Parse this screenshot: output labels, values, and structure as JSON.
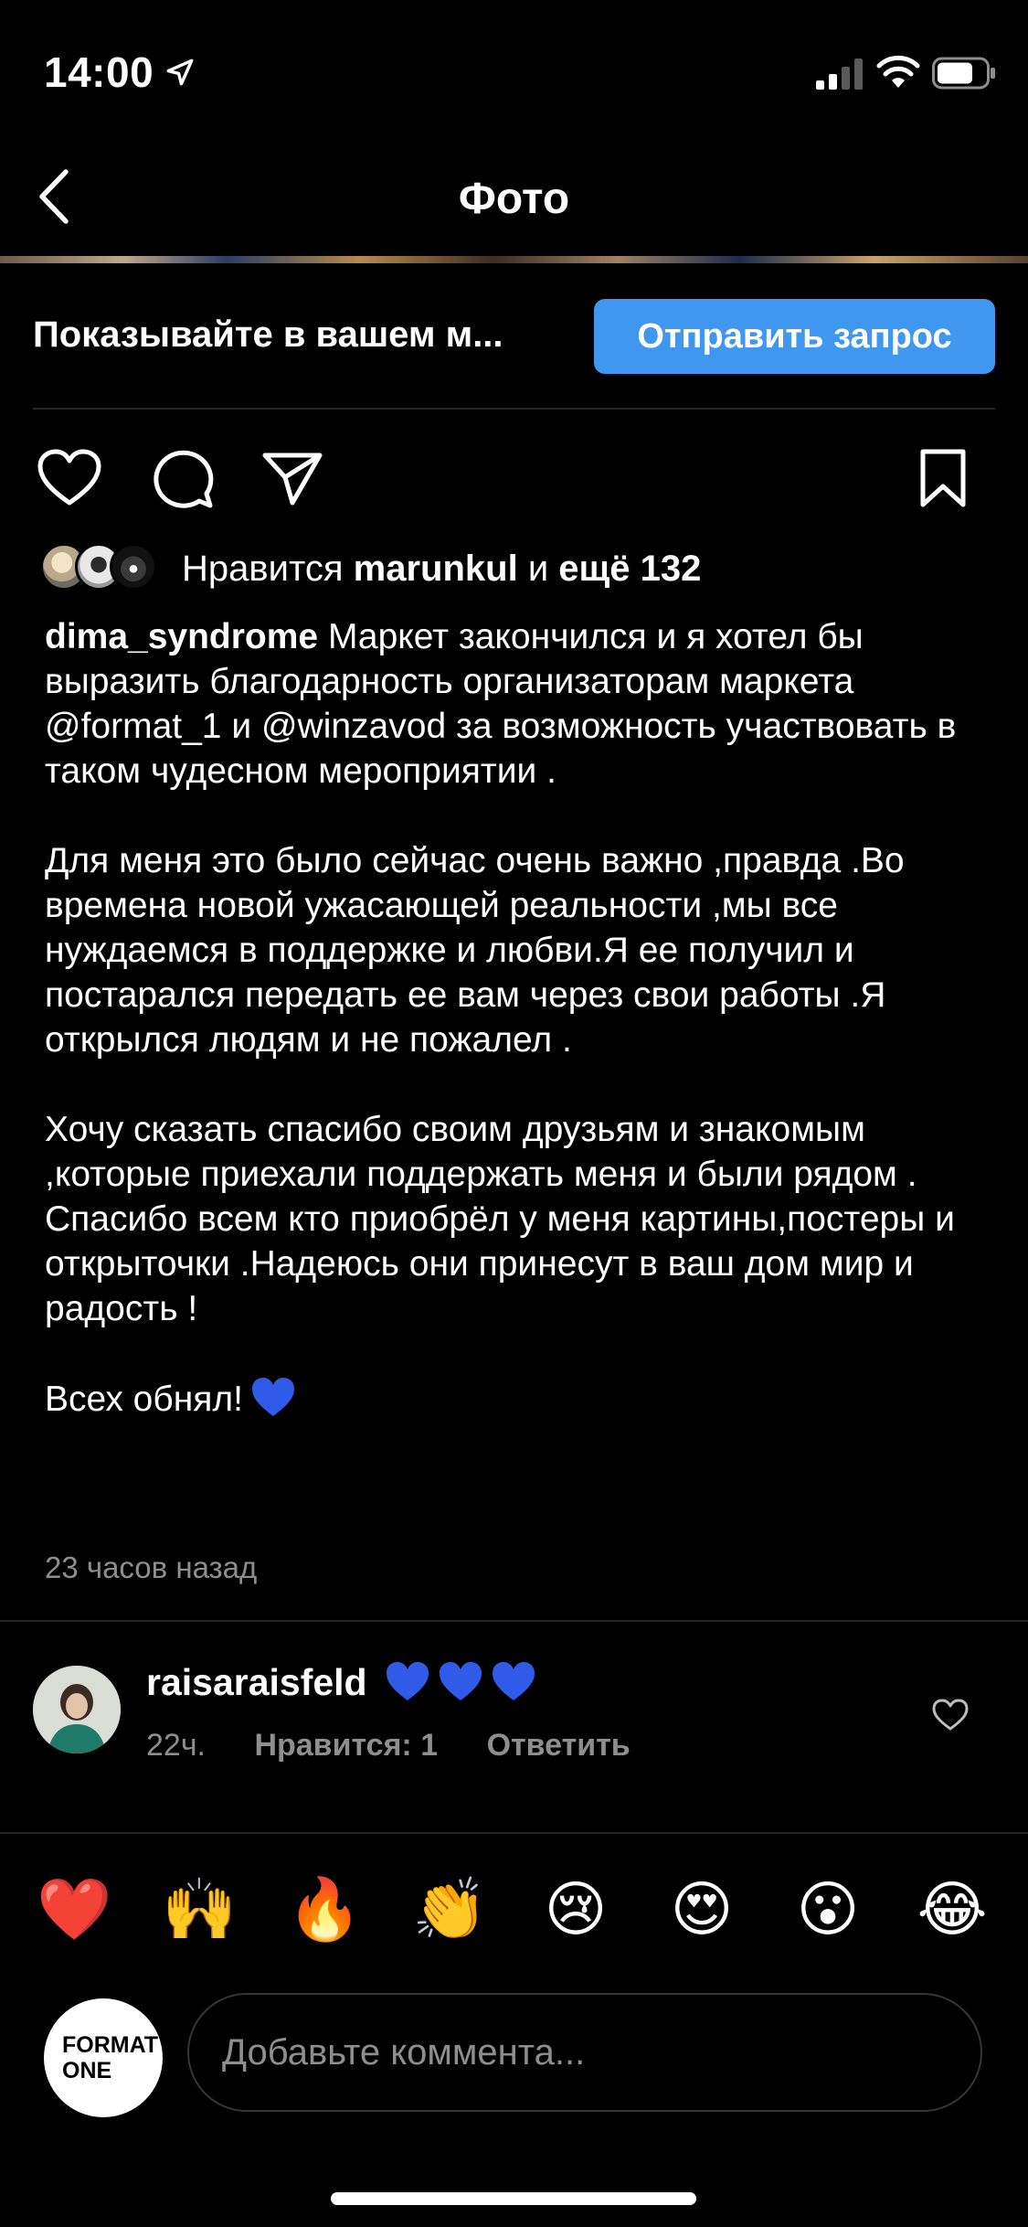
{
  "status_bar": {
    "time": "14:00"
  },
  "nav": {
    "title": "Фото"
  },
  "promo": {
    "text": "Показывайте в вашем м...",
    "button_label": "Отправить запрос"
  },
  "likes": {
    "prefix": "Нравится",
    "user": "marunkul",
    "middle": "и",
    "rest": "ещё 132"
  },
  "caption": {
    "username": "dima_syndrome",
    "p1": "Маркет закончился и я хотел бы выразить благодарность организаторам маркета @format_1 и @winzavod за возможность участвовать в таком чудесном мероприятии .",
    "p2": "Для меня это было сейчас очень важно ,правда .Во времена  новой ужасающей реальности ,мы все нуждаемся в поддержке и любви.Я ее получил и постарался передать ее вам через свои работы .Я открылся людям и не пожалел .",
    "p3a": "Хочу сказать спасибо своим друзьям и знакомым ,которые приехали поддержать меня  и были рядом .",
    "p3b": "Спасибо всем кто приобрёл у меня картины,постеры и открыточки .Надеюсь они принесут в ваш дом мир и радость !",
    "p4": "Всех обнял!",
    "time_ago": "23 часов назад"
  },
  "comment": {
    "username": "raisaraisfeld",
    "time": "22ч.",
    "likes": "Нравится: 1",
    "reply": "Ответить"
  },
  "emoji_bar": [
    "❤️",
    "🙌",
    "🔥",
    "👏",
    "😢",
    "😍",
    "😮",
    "😂"
  ],
  "self_avatar": {
    "line1": "FORMAT",
    "line2": "ONE"
  },
  "input": {
    "placeholder": "Добавьте коммента..."
  },
  "colors": {
    "accent": "#3f97f0",
    "heart_blue": "#2f5be8",
    "muted": "#8e8e8e"
  }
}
